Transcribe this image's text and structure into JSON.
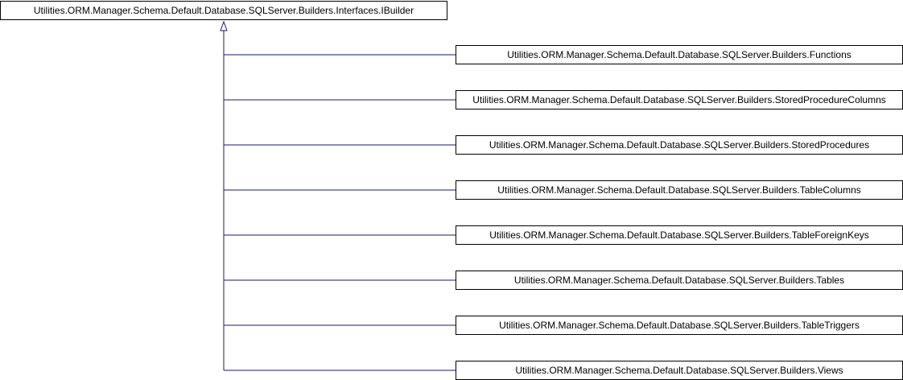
{
  "diagram": {
    "colors": {
      "edge": "#191970",
      "box_border": "#000000",
      "box_fill": "#ffffff",
      "text": "#000000"
    },
    "base_class": {
      "label": "Utilities.ORM.Manager.Schema.Default.Database.SQLServer.Builders.Interfaces.IBuilder"
    },
    "derived_classes": [
      {
        "label": "Utilities.ORM.Manager.Schema.Default.Database.SQLServer.Builders.Functions"
      },
      {
        "label": "Utilities.ORM.Manager.Schema.Default.Database.SQLServer.Builders.StoredProcedureColumns"
      },
      {
        "label": "Utilities.ORM.Manager.Schema.Default.Database.SQLServer.Builders.StoredProcedures"
      },
      {
        "label": "Utilities.ORM.Manager.Schema.Default.Database.SQLServer.Builders.TableColumns"
      },
      {
        "label": "Utilities.ORM.Manager.Schema.Default.Database.SQLServer.Builders.TableForeignKeys"
      },
      {
        "label": "Utilities.ORM.Manager.Schema.Default.Database.SQLServer.Builders.Tables"
      },
      {
        "label": "Utilities.ORM.Manager.Schema.Default.Database.SQLServer.Builders.TableTriggers"
      },
      {
        "label": "Utilities.ORM.Manager.Schema.Default.Database.SQLServer.Builders.Views"
      }
    ]
  }
}
